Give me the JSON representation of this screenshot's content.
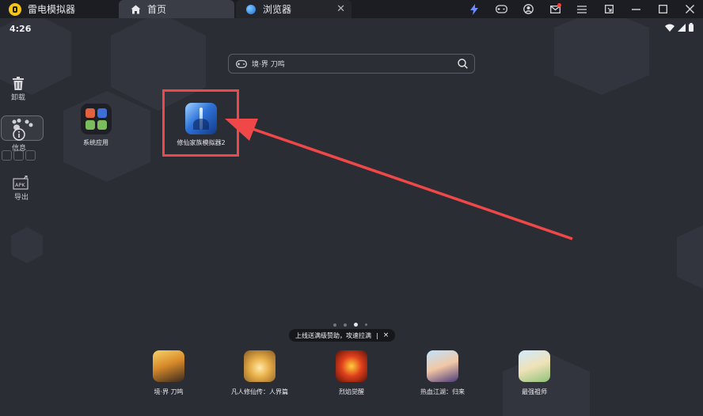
{
  "titlebar": {
    "app_name": "雷电模拟器",
    "tabs": [
      {
        "label": "首页",
        "icon": "home-icon",
        "active": true
      },
      {
        "label": "浏览器",
        "icon": "globe-icon",
        "active": false
      }
    ],
    "buttons": [
      "lightning-icon",
      "gamepad-icon",
      "user-icon",
      "mail-icon",
      "menu-icon",
      "restore-window-icon",
      "minimize-icon",
      "maximize-icon",
      "close-icon"
    ]
  },
  "statusbar": {
    "time": "4:26"
  },
  "search": {
    "query": "境·界 刀鸣"
  },
  "sidebar": {
    "items": [
      {
        "label": "卸载",
        "icon": "trash-icon"
      },
      {
        "label": "信息",
        "icon": "info-icon"
      },
      {
        "label": "导出",
        "icon": "apk-export-icon"
      }
    ]
  },
  "desktop": {
    "apps": [
      {
        "name": "系统应用",
        "icon": "folder-icon"
      },
      {
        "name": "修仙家族模拟器2",
        "icon": "game-icon",
        "highlighted": true
      }
    ]
  },
  "pager": {
    "count": 4,
    "active_index": 2
  },
  "promo": {
    "text": "上线送满级赞助，攻速拉满",
    "close": "×"
  },
  "dock": {
    "apps": [
      {
        "name": "境·界 刀鸣"
      },
      {
        "name": "凡人修仙传：人界篇"
      },
      {
        "name": "烈焰觉醒"
      },
      {
        "name": "热血江湖：归来"
      },
      {
        "name": "最强祖师"
      }
    ]
  },
  "colors": {
    "highlight": "#f04848",
    "accent": "#f7c516",
    "background": "#2b2d35"
  }
}
